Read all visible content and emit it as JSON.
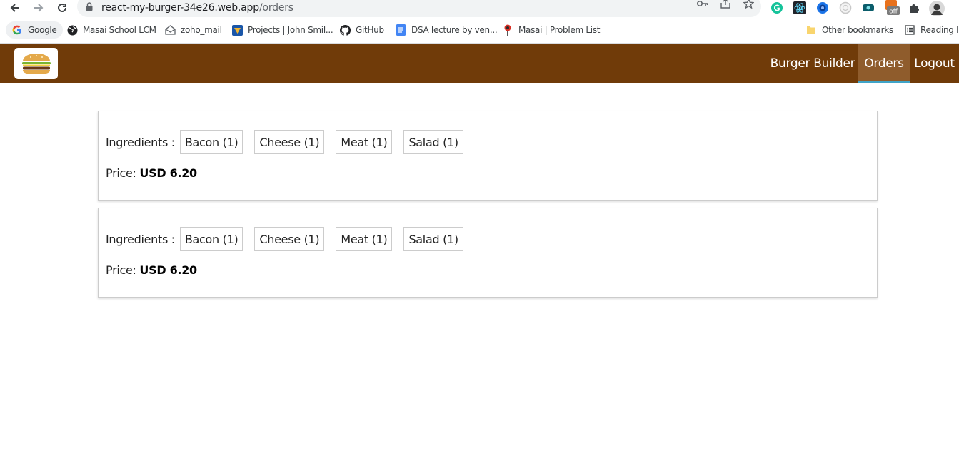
{
  "browser": {
    "url_host": "react-my-burger-34e26.web.app",
    "url_path": "/orders",
    "bookmarks": [
      {
        "label": "Google",
        "icon": "google-icon"
      },
      {
        "label": "Masai School LCM",
        "icon": "globe-icon"
      },
      {
        "label": "zoho_mail",
        "icon": "mail-icon"
      },
      {
        "label": "Projects | John Smil...",
        "icon": "project-icon"
      },
      {
        "label": "GitHub",
        "icon": "github-icon"
      },
      {
        "label": "DSA lecture by ven...",
        "icon": "docs-icon"
      },
      {
        "label": "Masai | Problem List",
        "icon": "masai-icon"
      }
    ],
    "other_bookmarks": "Other bookmarks",
    "reading_list": "Reading li",
    "extension_badge": "off"
  },
  "app": {
    "logo_icon": "burger-logo-icon",
    "nav": [
      {
        "label": "Burger Builder",
        "active": false
      },
      {
        "label": "Orders",
        "active": true
      },
      {
        "label": "Logout",
        "active": false
      }
    ],
    "colors": {
      "header": "#703b09",
      "active_tab": "#8f5c2c",
      "active_border": "#40a4c8"
    }
  },
  "orders": [
    {
      "ingredients_label": "Ingredients :",
      "ingredients": [
        "Bacon (1)",
        "Cheese (1)",
        "Meat (1)",
        "Salad (1)"
      ],
      "price_label": "Price:",
      "price_value": "USD 6.20"
    },
    {
      "ingredients_label": "Ingredients :",
      "ingredients": [
        "Bacon (1)",
        "Cheese (1)",
        "Meat (1)",
        "Salad (1)"
      ],
      "price_label": "Price:",
      "price_value": "USD 6.20"
    }
  ]
}
